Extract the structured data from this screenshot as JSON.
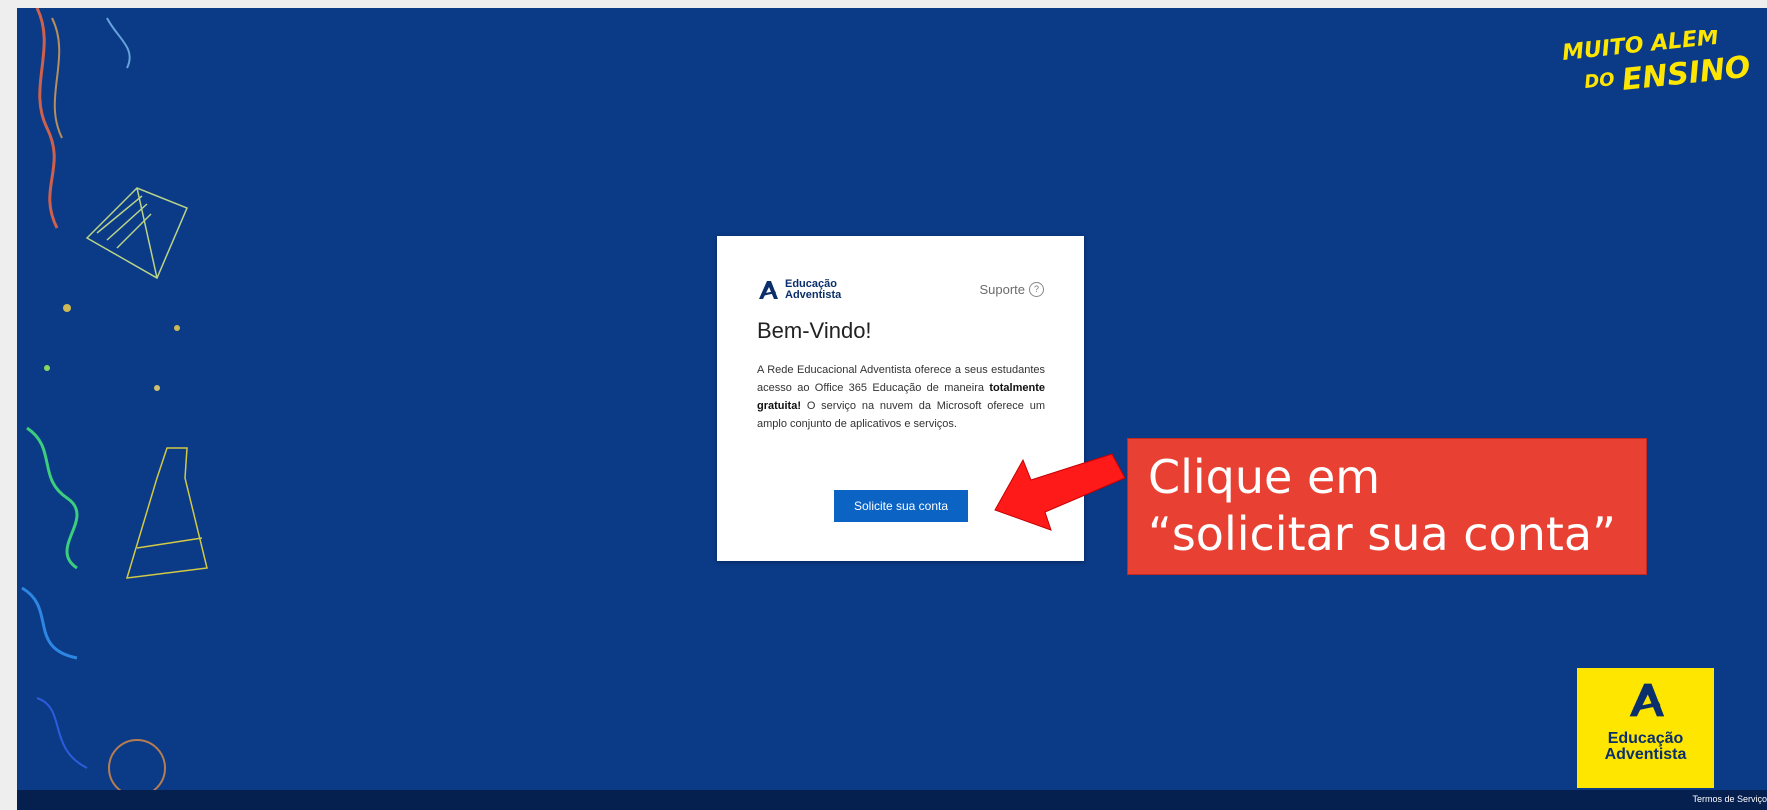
{
  "brand": {
    "logo_line1": "Educação",
    "logo_line2": "Adventista",
    "slogan_line1": "MUITO ALÉM",
    "slogan_line2": "DO",
    "slogan_line3": "ENSINO",
    "badge_line1": "Educação",
    "badge_line2": "Adventista"
  },
  "card": {
    "support_label": "Suporte",
    "support_icon": "question-circle-icon",
    "title": "Bem-Vindo!",
    "desc_part1": "A Rede Educacional Adventista oferece a seus estudantes acesso ao Office 365 Educação de maneira ",
    "desc_bold": "totalmente gratuita!",
    "desc_part2": " O serviço na nuvem da Microsoft oferece um amplo conjunto de aplicativos e serviços.",
    "cta_label": "Solicite sua conta"
  },
  "callout": {
    "line1": "Clique em",
    "line2": "“solicitar sua conta”"
  },
  "footer": {
    "terms_label": "Termos de Serviço"
  },
  "colors": {
    "background": "#0b3a87",
    "accent_yellow": "#ffe600",
    "button_blue": "#0b63c4",
    "callout_red": "#e84033",
    "arrow_red": "#ff0000"
  }
}
